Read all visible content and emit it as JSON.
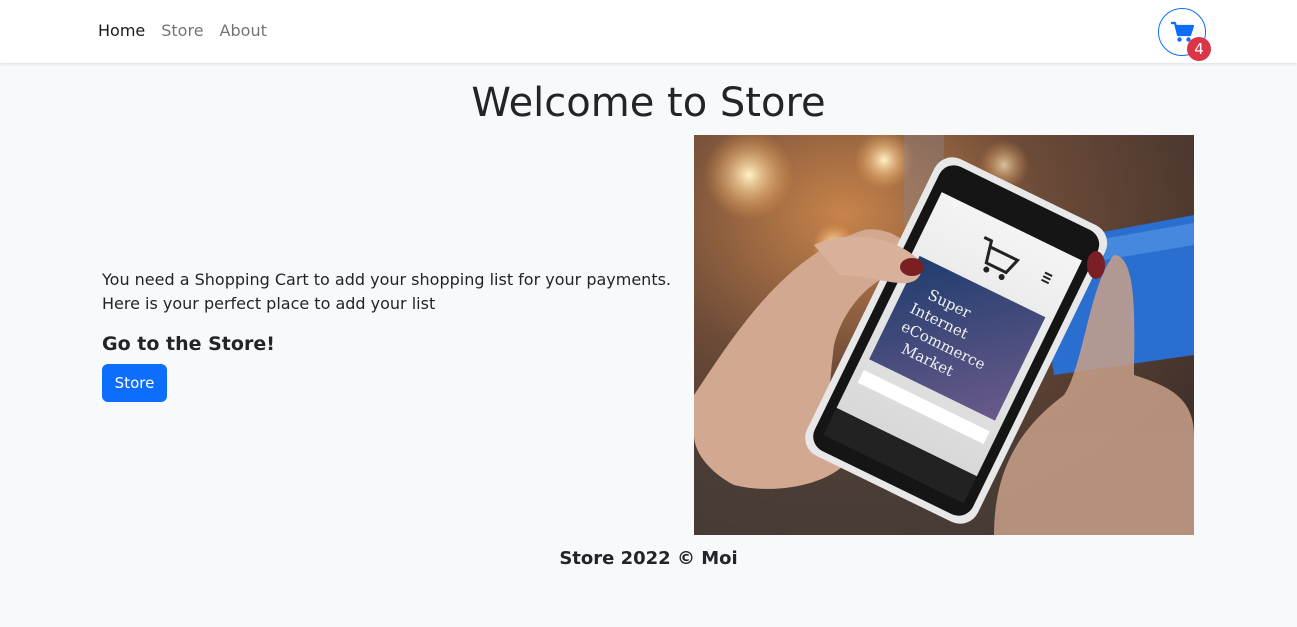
{
  "nav": {
    "items": [
      {
        "label": "Home",
        "active": true
      },
      {
        "label": "Store",
        "active": false
      },
      {
        "label": "About",
        "active": false
      }
    ],
    "cart_icon": "shopping-cart-icon",
    "cart_count": "4"
  },
  "colors": {
    "primary": "#0d6efd",
    "badge": "#dc3545",
    "background": "#f8f9fa"
  },
  "main": {
    "title": "Welcome to Store",
    "intro": "You need a Shopping Cart to add your shopping list for your payments. Here is your perfect place to add your list",
    "cta_heading": "Go to the Store!",
    "cta_button": "Store"
  },
  "footer": {
    "text": "Store 2022 © Moi"
  }
}
